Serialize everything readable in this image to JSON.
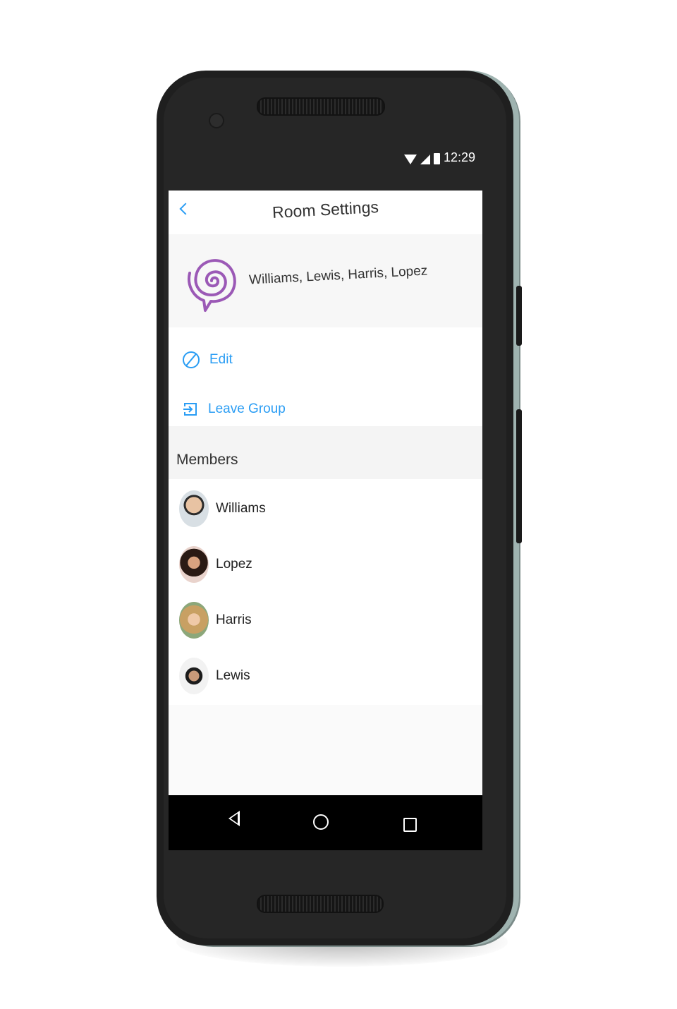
{
  "status_bar": {
    "time": "12:29",
    "icons": [
      "wifi-icon",
      "signal-icon",
      "battery-icon"
    ]
  },
  "app_bar": {
    "title": "Room Settings",
    "back_icon": "chevron-left-icon"
  },
  "room": {
    "name": "Williams, Lewis, Harris, Lopez",
    "logo_icon": "spiral-chat-logo-icon",
    "logo_color": "#9b59b6"
  },
  "actions": [
    {
      "label": "Edit",
      "icon": "edit-icon"
    },
    {
      "label": "Leave Group",
      "icon": "leave-icon"
    }
  ],
  "members_section": {
    "title": "Members",
    "members": [
      {
        "name": "Williams",
        "avatar": "avatar"
      },
      {
        "name": "Lopez",
        "avatar": "avatar"
      },
      {
        "name": "Harris",
        "avatar": "avatar"
      },
      {
        "name": "Lewis",
        "avatar": "avatar"
      }
    ]
  },
  "nav_bar": {
    "icons": [
      "back-triangle-icon",
      "home-circle-icon",
      "recents-square-icon"
    ]
  },
  "colors": {
    "accent": "#2a9df4",
    "brand_purple": "#9b59b6",
    "device_body": "#1f1f1f"
  }
}
